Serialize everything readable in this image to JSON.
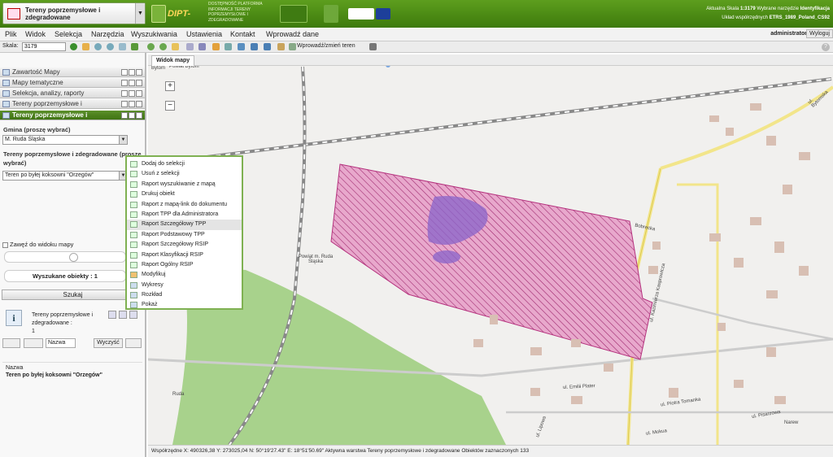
{
  "header": {
    "layer_selector": "Tereny poprzemysłowe i zdegradowane",
    "brand": "DIPT-TPP",
    "portal_text": "DOSTĘPNOŚĆ PLATFORMA INFORMACJI TERENY POPRZEMYSŁOWE I ZDEGRADOWANE",
    "status_line1": {
      "scale_label": "Aktualna Skala",
      "scale_value": "1:3179",
      "tool_label": "Wybrane narzędzie",
      "tool_value": "Identyfikacja"
    },
    "status_line2": {
      "crs_label": "Układ współrzędnych",
      "crs_value": "ETRS_1989_Poland_CS92"
    }
  },
  "menu": {
    "items": [
      "Plik",
      "Widok",
      "Selekcja",
      "Narzędzia",
      "Wyszukiwania",
      "Ustawienia",
      "Kontakt",
      "Wprowadź dane"
    ],
    "user": "administrator",
    "logout": "Wyloguj"
  },
  "toolbar": {
    "scale_label": "Skala:",
    "scale_value": "3179",
    "wprowadz": "Wprowadź/zmień teren"
  },
  "panel": {
    "sections": [
      "Zawartość Mapy",
      "Mapy tematyczne",
      "Selekcja, analizy, raporty",
      "Tereny poprzemysłowe i"
    ],
    "active_section": "Tereny poprzemysłowe i",
    "gmina_label": "Gmina (proszę wybrać)",
    "gmina_value": "M. Ruda Śląska",
    "tpp_label": "Tereny poprzemysłowe i zdegradowane (proszę wybrać)",
    "tpp_value": "Teren po byłej koksowni \"Orzegów\"",
    "zawez": "Zawęź do widoku mapy",
    "found": "Wyszukane obiekty : 1",
    "search": "Szukaj",
    "result_text": "Tereny poprzemysłowe i zdegradowane :",
    "result_count": "1",
    "sort_select": "Nazwa",
    "clear": "Wyczyść",
    "bottom_label": "Nazwa",
    "bottom_value": "Teren po byłej koksowni \"Orzegów\""
  },
  "map": {
    "tab": "Widok mapy",
    "labels": {
      "powiat_bytom": "Powiat Bytom",
      "bytom": "Bytom",
      "powiat_ruda": "Powiat m. Ruda Śląska",
      "bobrecka": "Bobrecka",
      "kasprowicza": "ul. Kazimierza Kasprowicza",
      "emilii": "ul. Emilii Plater",
      "tomanka": "ul. Piotra Tomanka",
      "bytomska": "ul. Bytomska",
      "lipowa": "ul. Lipowa",
      "pisarzowa": "ul. Pisarzowa",
      "ruda": "Ruda",
      "narew": "Narew",
      "mokua": "ul. Mokua"
    }
  },
  "context_menu": {
    "items": [
      "Dodaj do selekcji",
      "Usuń z selekcji",
      "Raport wyszukiwanie z mapą",
      "Drukuj obiekt",
      "Raport z mapą-link do dokumentu",
      "Raport TPP dla Administratora",
      "Raport Szczegółowy TPP",
      "Raport Podstawowy TPP",
      "Raport Szczegółowy RSIP",
      "Raport Klasyfikacji RSIP",
      "Raport Ogólny RSIP",
      "Modyfikuj",
      "Wykresy",
      "Rozkład",
      "Pokaż"
    ],
    "highlighted": "Raport Szczegółowy TPP"
  },
  "statusbar": {
    "text": "Współrzędne X: 490326,38 Y: 273025,04   N: 50°19'27.43\"  E: 18°51'50.69\"   Aktywna warstwa Tereny poprzemysłowe i zdegradowane   Obiektów zaznaczonych 133"
  },
  "colors": {
    "header_green": "#4d8c17",
    "polygon": "#c23b8a",
    "park": "#a8d28c",
    "road_yellow": "#f2e58a"
  }
}
